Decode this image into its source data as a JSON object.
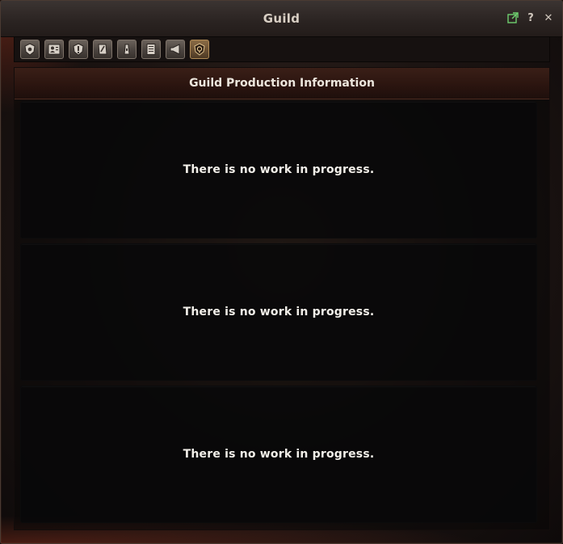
{
  "window": {
    "title": "Guild"
  },
  "title_controls": {
    "help_label": "?",
    "close_label": "✕"
  },
  "toolbar": {
    "buttons": [
      {
        "icon": "guild-emblem-icon",
        "active": false
      },
      {
        "icon": "members-icon",
        "active": false
      },
      {
        "icon": "notice-icon",
        "active": false
      },
      {
        "icon": "quest-scroll-icon",
        "active": false
      },
      {
        "icon": "tower-icon",
        "active": false
      },
      {
        "icon": "document-icon",
        "active": false
      },
      {
        "icon": "megaphone-icon",
        "active": false
      },
      {
        "icon": "production-icon",
        "active": true
      }
    ]
  },
  "main": {
    "title": "Guild Production Information",
    "panels": [
      {
        "message": "There is no work in progress."
      },
      {
        "message": "There is no work in progress."
      },
      {
        "message": "There is no work in progress."
      }
    ]
  },
  "colors": {
    "accent_active": "#b08a55",
    "header_bg": "#2a140f",
    "panel_bg": "#080809",
    "text": "#f2efe9",
    "popout_icon": "#6fcf6f"
  }
}
